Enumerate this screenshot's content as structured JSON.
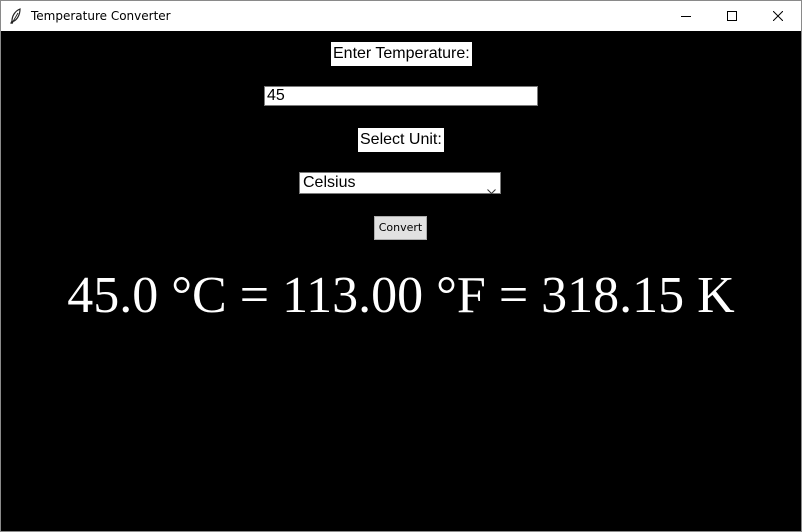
{
  "window": {
    "title": "Temperature Converter",
    "icons": {
      "app": "feather-icon",
      "minimize": "minimize-icon",
      "maximize": "maximize-icon",
      "close": "close-icon"
    }
  },
  "form": {
    "temperature_label": "Enter Temperature:",
    "temperature_value": "45",
    "unit_label": "Select Unit:",
    "unit_selected": "Celsius",
    "convert_label": "Convert"
  },
  "result": {
    "text": "45.0 °C = 113.00 °F = 318.15 K"
  },
  "colors": {
    "background": "#000000",
    "label_background": "#ffffff",
    "result_text": "#ffffff"
  }
}
